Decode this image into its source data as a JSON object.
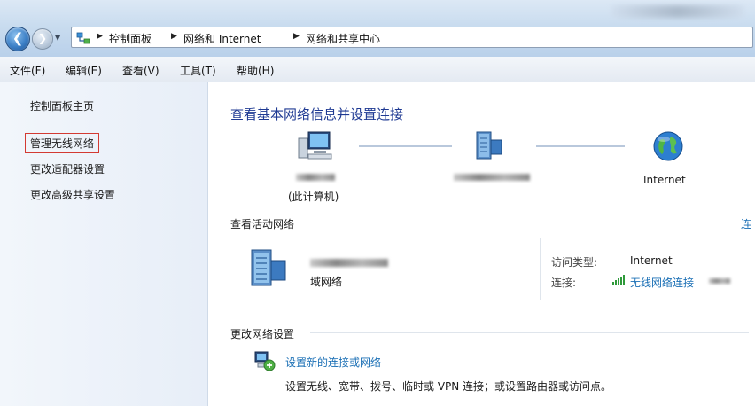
{
  "breadcrumb": {
    "items": [
      "控制面板",
      "网络和 Internet",
      "网络和共享中心"
    ]
  },
  "menu": {
    "items": [
      "文件(F)",
      "编辑(E)",
      "查看(V)",
      "工具(T)",
      "帮助(H)"
    ]
  },
  "sidebar": {
    "items": [
      {
        "label": "控制面板主页"
      },
      {
        "label": "管理无线网络"
      },
      {
        "label": "更改适配器设置"
      },
      {
        "label": "更改高级共享设置"
      }
    ]
  },
  "main": {
    "title": "查看基本网络信息并设置连接",
    "map": {
      "computer_sub_label": "(此计算机)",
      "internet_label": "Internet"
    },
    "active_networks": {
      "title": "查看活动网络",
      "link_partial": "连",
      "network_type": "域网络",
      "access_type_label": "访问类型:",
      "access_type_value": "Internet",
      "connection_label": "连接:",
      "connection_value": "无线网络连接"
    },
    "change_settings": {
      "title": "更改网络设置",
      "setup_link": "设置新的连接或网络",
      "setup_desc": "设置无线、宽带、拨号、临时或 VPN 连接；或设置路由器或访问点。"
    }
  },
  "colors": {
    "title_blue": "#1f3a93",
    "link_blue": "#1a6fb5",
    "highlight_red": "#d33a32"
  }
}
